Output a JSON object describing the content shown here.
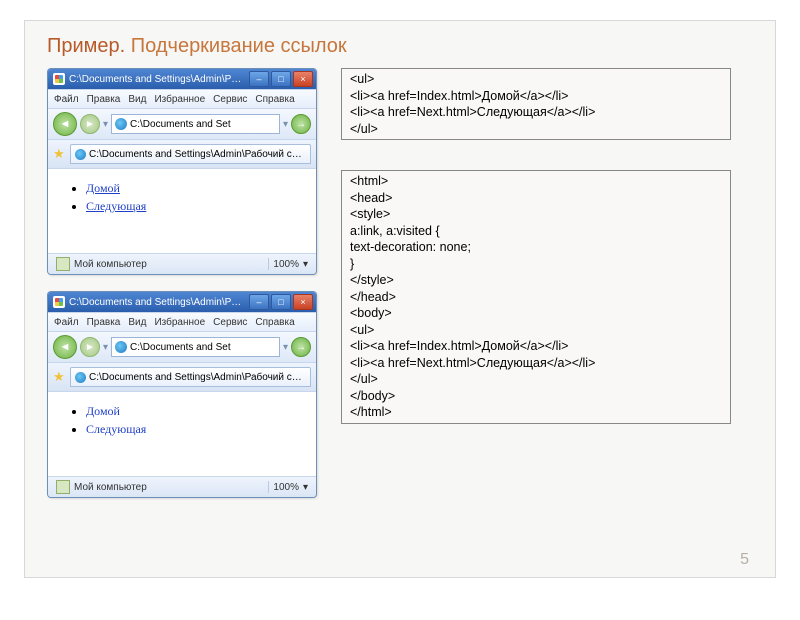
{
  "slide": {
    "title_prefix": "Пример.",
    "title_rest": " Подчеркивание ссылок",
    "page_number": "5"
  },
  "browser": {
    "titlebar_text": "C:\\Documents and Settings\\Admin\\P…",
    "menu": [
      "Файл",
      "Правка",
      "Вид",
      "Избранное",
      "Сервис",
      "Справка"
    ],
    "address": "C:\\Documents and Set",
    "tab_text": "C:\\Documents and Settings\\Admin\\Рабочий с…",
    "status_left": "Мой компьютер",
    "zoom": "100%",
    "links": {
      "home": "Домой",
      "next": "Следующая"
    }
  },
  "code": {
    "box1": "<ul>\n<li><a href=Index.html>Домой</a></li>\n<li><a href=Next.html>Следующая</a></li>\n</ul>",
    "box2": "<html>\n<head>\n<style>\na:link, a:visited {\ntext-decoration: none;\n}\n</style>\n</head>\n<body>\n<ul>\n<li><a href=Index.html>Домой</a></li>\n<li><a href=Next.html>Следующая</a></li>\n</ul>\n</body>\n</html>"
  }
}
